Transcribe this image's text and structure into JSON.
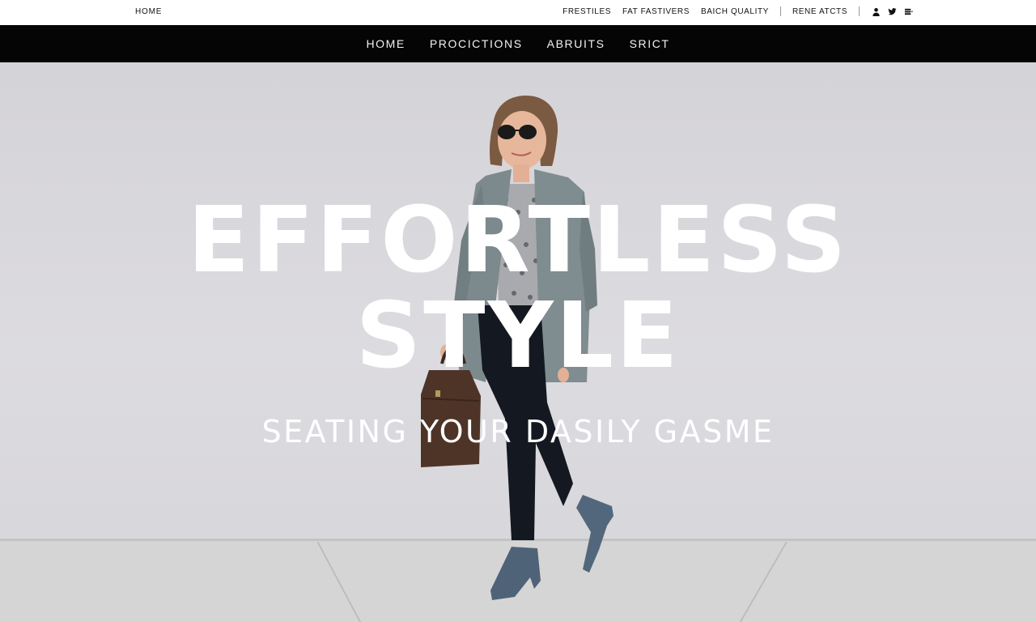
{
  "utility": {
    "home": "HOME",
    "links": [
      "FRESTILES",
      "FAT FASTIVERS",
      "BAICH QUALITY",
      "RENE ATCTS"
    ],
    "icons": [
      "user-icon",
      "twitter-icon",
      "menu-icon"
    ]
  },
  "nav": {
    "items": [
      "HOME",
      "PROCICTIONS",
      "ABRUITS",
      "SRICT"
    ]
  },
  "hero": {
    "title_line1": "EFFORTLESS",
    "title_line2": "STYLE",
    "subtitle": "SEATING YOUR DASILY GASME"
  },
  "colors": {
    "nav_bg": "#050505",
    "hero_bg": "#d9d8dc",
    "text_light": "#ffffff"
  }
}
